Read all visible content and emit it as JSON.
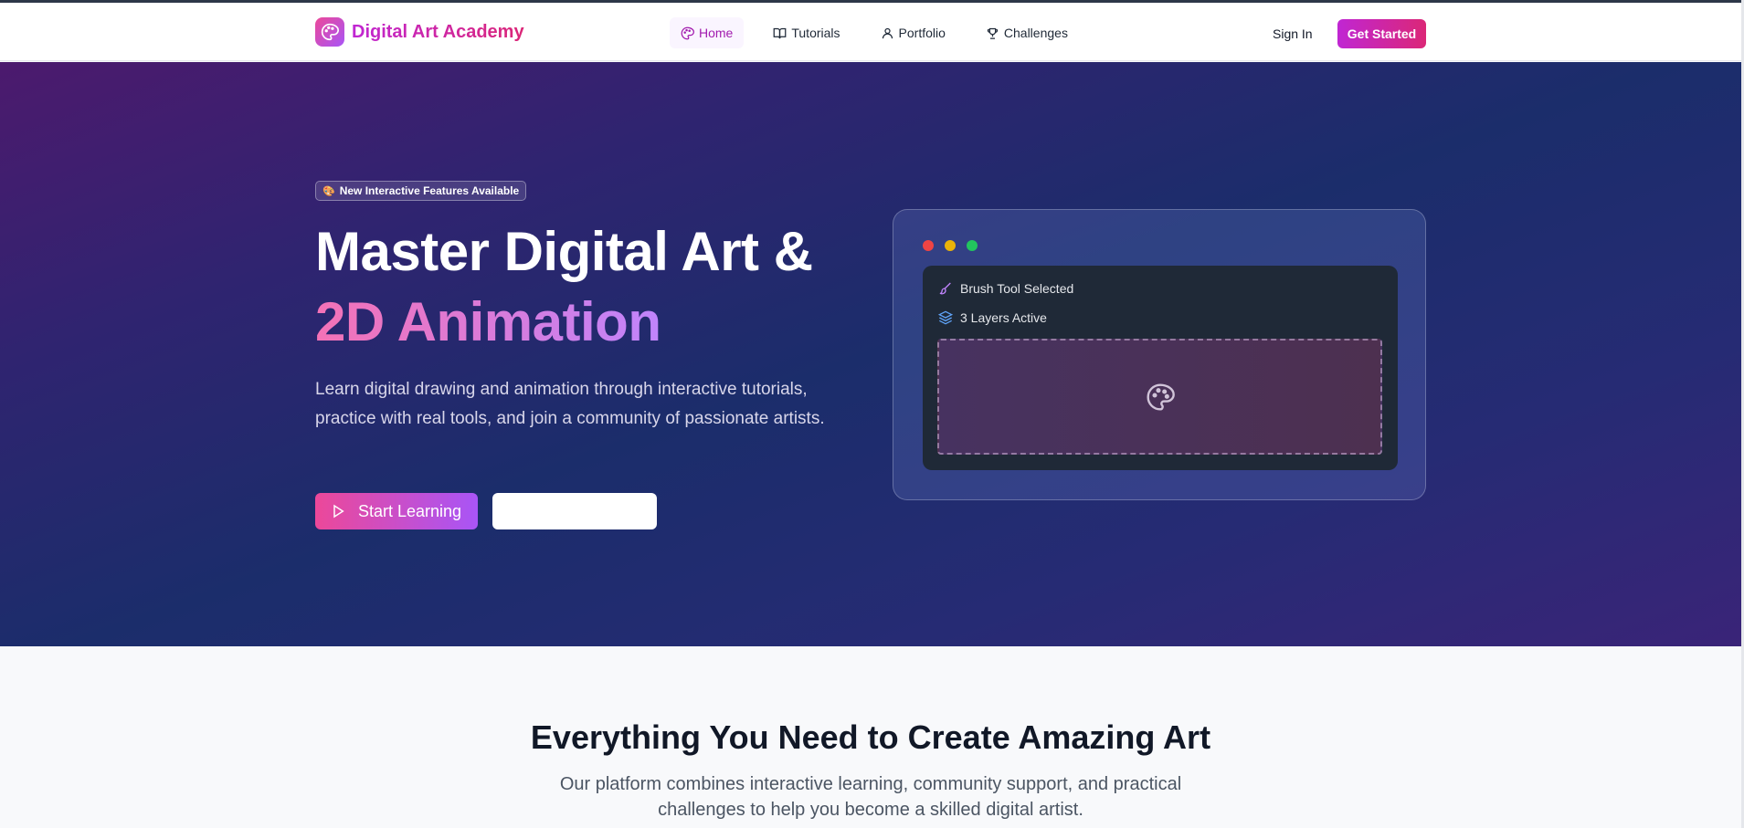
{
  "brand": {
    "name": "Digital Art Academy",
    "icon": "palette-icon"
  },
  "nav": {
    "items": [
      {
        "label": "Home",
        "icon": "palette-icon",
        "active": true
      },
      {
        "label": "Tutorials",
        "icon": "book-open-icon",
        "active": false
      },
      {
        "label": "Portfolio",
        "icon": "user-icon",
        "active": false
      },
      {
        "label": "Challenges",
        "icon": "trophy-icon",
        "active": false
      }
    ],
    "sign_in": "Sign In",
    "get_started": "Get Started"
  },
  "hero": {
    "badge": "New Interactive Features Available",
    "title_line1": "Master Digital Art &",
    "title_line2": "2D Animation",
    "description": "Learn digital drawing and animation through interactive tutorials, practice with real tools, and join a community of passionate artists.",
    "primary_button": "Start Learning",
    "secondary_button": ""
  },
  "mockup": {
    "tool_status": "Brush Tool Selected",
    "layers_status": "3 Layers Active",
    "window_dots": [
      "#ef4444",
      "#eab308",
      "#22c55e"
    ]
  },
  "features": {
    "title": "Everything You Need to Create Amazing Art",
    "subtitle": "Our platform combines interactive learning, community support, and practical challenges to help you become a skilled digital artist."
  },
  "colors": {
    "accent": "#c026d3",
    "pink": "#db2777"
  }
}
